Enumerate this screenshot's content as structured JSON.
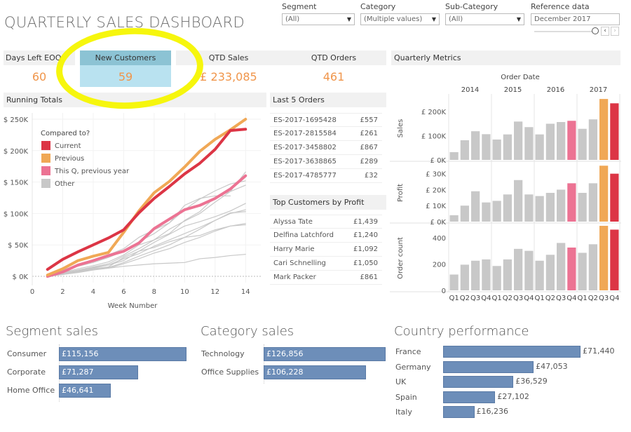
{
  "title": "QUARTERLY SALES DASHBOARD",
  "filters": [
    {
      "label": "Segment",
      "value": "(All)"
    },
    {
      "label": "Category",
      "value": "(Multiple values)"
    },
    {
      "label": "Sub-Category",
      "value": "(All)"
    }
  ],
  "reference": {
    "label": "Reference data",
    "value": "December 2017",
    "prev_icon": "‹",
    "next_icon": "›"
  },
  "kpis": [
    {
      "label": "Days Left EOQ",
      "value": "60"
    },
    {
      "label": "New Customers",
      "value": "59"
    },
    {
      "label": "QTD Sales",
      "value": "£ 233,085"
    },
    {
      "label": "QTD Orders",
      "value": "461"
    }
  ],
  "colors": {
    "current": "#dc3545",
    "previous": "#f0a856",
    "this_q_prev_year": "#ec7393",
    "other": "#c8c8c8",
    "kpi_value": "#f0954a",
    "bar_blue": "#6d8eb9",
    "highlight": "#f5f500"
  },
  "running_totals": {
    "title": "Running Totals",
    "legend_title": "Compared to?",
    "legend": [
      "Current",
      "Previous",
      "This Q, previous year",
      "Other"
    ]
  },
  "last_orders": {
    "title": "Last 5 Orders",
    "rows": [
      {
        "id": "ES-2017-1695428",
        "value": "£557"
      },
      {
        "id": "ES-2017-2815584",
        "value": "£261"
      },
      {
        "id": "ES-2017-3458802",
        "value": "£867"
      },
      {
        "id": "ES-2017-3638865",
        "value": "£289"
      },
      {
        "id": "ES-2017-4785777",
        "value": "£32"
      }
    ]
  },
  "top_customers": {
    "title": "Top Customers by Profit",
    "rows": [
      {
        "name": "Alyssa Tate",
        "value": "£1,439"
      },
      {
        "name": "Delfina Latchford",
        "value": "£1,240"
      },
      {
        "name": "Harry Marie",
        "value": "£1,092"
      },
      {
        "name": "Cari Schnelling",
        "value": "£1,050"
      },
      {
        "name": "Mark Packer",
        "value": "£861"
      }
    ]
  },
  "quarterly_metrics": {
    "title": "Quarterly Metrics"
  },
  "segment_sales": {
    "title": "Segment sales"
  },
  "category_sales": {
    "title": "Category sales"
  },
  "country_performance": {
    "title": "Country performance"
  },
  "chart_data": [
    {
      "type": "line",
      "title": "Running Totals",
      "xlabel": "Week Number",
      "ylabel": "",
      "xlim": [
        0,
        15
      ],
      "ylim": [
        -10000,
        260000
      ],
      "x_ticks": [
        0,
        2,
        4,
        6,
        8,
        10,
        12,
        14
      ],
      "y_ticks": [
        0,
        50000,
        100000,
        150000,
        200000,
        250000
      ],
      "y_tick_labels": [
        "$ 0K",
        "$ 50K",
        "$ 100K",
        "$ 150K",
        "$ 200K",
        "$ 250K"
      ],
      "legend_title": "Compared to?",
      "legend_position": "top-left",
      "x": [
        1,
        2,
        3,
        4,
        5,
        6,
        7,
        8,
        9,
        10,
        11,
        12,
        13,
        14
      ],
      "series": [
        {
          "name": "Current",
          "role": "current",
          "values": [
            11000,
            27000,
            39000,
            50000,
            61000,
            74000,
            101000,
            124000,
            143000,
            163000,
            180000,
            202000,
            232000,
            234000
          ]
        },
        {
          "name": "Previous",
          "role": "previous",
          "values": [
            2000,
            12000,
            25000,
            32000,
            38000,
            70000,
            104000,
            133000,
            151000,
            174000,
            199000,
            218000,
            233000,
            250000
          ]
        },
        {
          "name": "This Q, previous year",
          "role": "this_q_prev_year",
          "values": [
            0,
            7000,
            18000,
            25000,
            33000,
            40000,
            53000,
            76000,
            91000,
            106000,
            113000,
            124000,
            139000,
            160000
          ]
        },
        {
          "name": "Other",
          "role": "other",
          "values": [
            0,
            6000,
            12000,
            17000,
            23000,
            34000,
            50000,
            58000,
            75000,
            88000,
            100000,
            118000,
            135000,
            166000
          ]
        },
        {
          "name": "Other",
          "role": "other",
          "values": [
            1000,
            9000,
            16000,
            22000,
            30000,
            40000,
            55000,
            68000,
            85000,
            106000,
            123000,
            136000,
            147000,
            152000
          ]
        },
        {
          "name": "Other",
          "role": "other",
          "values": [
            2000,
            10000,
            18000,
            26000,
            34000,
            44000,
            62000,
            74000,
            85000,
            113000,
            124000,
            128000,
            128000,
            null
          ]
        },
        {
          "name": "Other",
          "role": "other",
          "values": [
            0,
            5000,
            10000,
            15000,
            20000,
            32000,
            44000,
            58000,
            68000,
            89000,
            103000,
            126000,
            135000,
            145000
          ]
        },
        {
          "name": "Other",
          "role": "other",
          "values": [
            0,
            4000,
            9000,
            13000,
            18000,
            25000,
            40000,
            54000,
            67000,
            80000,
            87000,
            95000,
            104000,
            116000
          ]
        },
        {
          "name": "Other",
          "role": "other",
          "values": [
            0,
            5000,
            10000,
            14000,
            18000,
            28000,
            36000,
            48000,
            58000,
            68000,
            78000,
            89000,
            100000,
            106000
          ]
        },
        {
          "name": "Other",
          "role": "other",
          "values": [
            0,
            3000,
            7000,
            11000,
            14000,
            22000,
            32000,
            41000,
            50000,
            62000,
            75000,
            89000,
            101000,
            103000
          ]
        },
        {
          "name": "Other",
          "role": "other",
          "values": [
            0,
            3000,
            6000,
            10000,
            13000,
            20000,
            28000,
            37000,
            44000,
            54000,
            62000,
            72000,
            80000,
            82000
          ]
        },
        {
          "name": "Other",
          "role": "other",
          "values": [
            0,
            4000,
            8000,
            12000,
            15000,
            30000,
            40000,
            46000,
            55000,
            62000,
            65000,
            74000,
            80000,
            84000
          ]
        },
        {
          "name": "Other",
          "role": "other",
          "values": [
            0,
            6000,
            9000,
            11000,
            13000,
            16000,
            18000,
            20000,
            21000,
            22000,
            28000,
            30000,
            33000,
            35000
          ]
        }
      ]
    },
    {
      "type": "bar",
      "title": "Quarterly Metrics",
      "column_header": "Order Date",
      "years": [
        "2014",
        "2015",
        "2016",
        "2017"
      ],
      "categories": [
        "Q1",
        "Q2",
        "Q3",
        "Q4",
        "Q1",
        "Q2",
        "Q3",
        "Q4",
        "Q1",
        "Q2",
        "Q3",
        "Q4",
        "Q1",
        "Q2",
        "Q3",
        "Q4"
      ],
      "bar_roles": [
        "other",
        "other",
        "other",
        "other",
        "other",
        "other",
        "other",
        "other",
        "other",
        "other",
        "other",
        "this_q_prev_year",
        "other",
        "other",
        "previous",
        "current"
      ],
      "panels": [
        {
          "name": "Sales",
          "ylim": [
            0,
            260000
          ],
          "y_ticks": [
            0,
            100000,
            200000
          ],
          "y_tick_labels": [
            "£ 0K",
            "£ 100K",
            "£ 200K"
          ],
          "values": [
            32000,
            81000,
            118000,
            106000,
            84000,
            105000,
            158000,
            135000,
            105000,
            149000,
            156000,
            161000,
            128000,
            167000,
            251000,
            233085
          ]
        },
        {
          "name": "Profit",
          "ylim": [
            0,
            36000
          ],
          "y_ticks": [
            0,
            10000,
            20000,
            30000
          ],
          "y_tick_labels": [
            "£ 0K",
            "£ 10K",
            "£ 20K",
            "£ 30K"
          ],
          "values": [
            4000,
            10000,
            19000,
            12000,
            13000,
            17000,
            26000,
            17000,
            16000,
            18000,
            20000,
            24000,
            18000,
            24000,
            35000,
            30000
          ]
        },
        {
          "name": "Order count",
          "ylim": [
            0,
            490
          ],
          "y_ticks": [
            0,
            200,
            400
          ],
          "y_tick_labels": [
            "0",
            "200",
            "400"
          ],
          "values": [
            120,
            195,
            225,
            235,
            185,
            235,
            315,
            300,
            225,
            270,
            360,
            325,
            285,
            350,
            490,
            461
          ]
        }
      ]
    },
    {
      "type": "bar",
      "orientation": "horizontal",
      "title": "Segment sales",
      "categories": [
        "Consumer",
        "Corporate",
        "Home Office"
      ],
      "values": [
        115156,
        71287,
        46641
      ],
      "labels": [
        "£115,156",
        "£71,287",
        "£46,641"
      ]
    },
    {
      "type": "bar",
      "orientation": "horizontal",
      "title": "Category sales",
      "categories": [
        "Technology",
        "Office Supplies"
      ],
      "values": [
        126856,
        106228
      ],
      "labels": [
        "£126,856",
        "£106,228"
      ]
    },
    {
      "type": "bar",
      "orientation": "horizontal",
      "title": "Country performance",
      "categories": [
        "France",
        "Germany",
        "UK",
        "Spain",
        "Italy"
      ],
      "values": [
        71440,
        47053,
        36529,
        27102,
        16236
      ],
      "labels": [
        "£71,440",
        "£47,053",
        "£36,529",
        "£27,102",
        "£16,236"
      ]
    }
  ]
}
